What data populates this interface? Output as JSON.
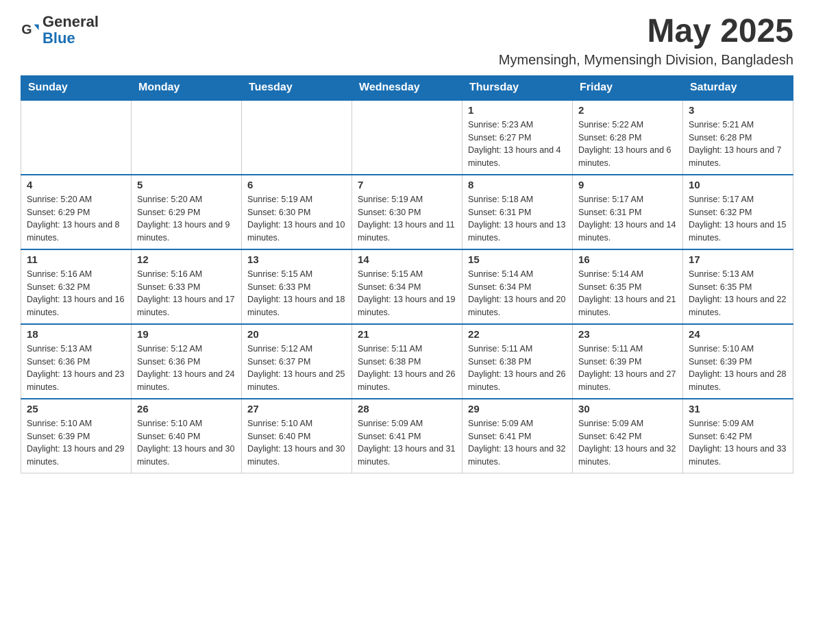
{
  "header": {
    "logo": {
      "general": "General",
      "blue": "Blue"
    },
    "title": "May 2025",
    "subtitle": "Mymensingh, Mymensingh Division, Bangladesh"
  },
  "calendar": {
    "days_of_week": [
      "Sunday",
      "Monday",
      "Tuesday",
      "Wednesday",
      "Thursday",
      "Friday",
      "Saturday"
    ],
    "weeks": [
      [
        {
          "day": "",
          "info": ""
        },
        {
          "day": "",
          "info": ""
        },
        {
          "day": "",
          "info": ""
        },
        {
          "day": "",
          "info": ""
        },
        {
          "day": "1",
          "info": "Sunrise: 5:23 AM\nSunset: 6:27 PM\nDaylight: 13 hours and 4 minutes."
        },
        {
          "day": "2",
          "info": "Sunrise: 5:22 AM\nSunset: 6:28 PM\nDaylight: 13 hours and 6 minutes."
        },
        {
          "day": "3",
          "info": "Sunrise: 5:21 AM\nSunset: 6:28 PM\nDaylight: 13 hours and 7 minutes."
        }
      ],
      [
        {
          "day": "4",
          "info": "Sunrise: 5:20 AM\nSunset: 6:29 PM\nDaylight: 13 hours and 8 minutes."
        },
        {
          "day": "5",
          "info": "Sunrise: 5:20 AM\nSunset: 6:29 PM\nDaylight: 13 hours and 9 minutes."
        },
        {
          "day": "6",
          "info": "Sunrise: 5:19 AM\nSunset: 6:30 PM\nDaylight: 13 hours and 10 minutes."
        },
        {
          "day": "7",
          "info": "Sunrise: 5:19 AM\nSunset: 6:30 PM\nDaylight: 13 hours and 11 minutes."
        },
        {
          "day": "8",
          "info": "Sunrise: 5:18 AM\nSunset: 6:31 PM\nDaylight: 13 hours and 13 minutes."
        },
        {
          "day": "9",
          "info": "Sunrise: 5:17 AM\nSunset: 6:31 PM\nDaylight: 13 hours and 14 minutes."
        },
        {
          "day": "10",
          "info": "Sunrise: 5:17 AM\nSunset: 6:32 PM\nDaylight: 13 hours and 15 minutes."
        }
      ],
      [
        {
          "day": "11",
          "info": "Sunrise: 5:16 AM\nSunset: 6:32 PM\nDaylight: 13 hours and 16 minutes."
        },
        {
          "day": "12",
          "info": "Sunrise: 5:16 AM\nSunset: 6:33 PM\nDaylight: 13 hours and 17 minutes."
        },
        {
          "day": "13",
          "info": "Sunrise: 5:15 AM\nSunset: 6:33 PM\nDaylight: 13 hours and 18 minutes."
        },
        {
          "day": "14",
          "info": "Sunrise: 5:15 AM\nSunset: 6:34 PM\nDaylight: 13 hours and 19 minutes."
        },
        {
          "day": "15",
          "info": "Sunrise: 5:14 AM\nSunset: 6:34 PM\nDaylight: 13 hours and 20 minutes."
        },
        {
          "day": "16",
          "info": "Sunrise: 5:14 AM\nSunset: 6:35 PM\nDaylight: 13 hours and 21 minutes."
        },
        {
          "day": "17",
          "info": "Sunrise: 5:13 AM\nSunset: 6:35 PM\nDaylight: 13 hours and 22 minutes."
        }
      ],
      [
        {
          "day": "18",
          "info": "Sunrise: 5:13 AM\nSunset: 6:36 PM\nDaylight: 13 hours and 23 minutes."
        },
        {
          "day": "19",
          "info": "Sunrise: 5:12 AM\nSunset: 6:36 PM\nDaylight: 13 hours and 24 minutes."
        },
        {
          "day": "20",
          "info": "Sunrise: 5:12 AM\nSunset: 6:37 PM\nDaylight: 13 hours and 25 minutes."
        },
        {
          "day": "21",
          "info": "Sunrise: 5:11 AM\nSunset: 6:38 PM\nDaylight: 13 hours and 26 minutes."
        },
        {
          "day": "22",
          "info": "Sunrise: 5:11 AM\nSunset: 6:38 PM\nDaylight: 13 hours and 26 minutes."
        },
        {
          "day": "23",
          "info": "Sunrise: 5:11 AM\nSunset: 6:39 PM\nDaylight: 13 hours and 27 minutes."
        },
        {
          "day": "24",
          "info": "Sunrise: 5:10 AM\nSunset: 6:39 PM\nDaylight: 13 hours and 28 minutes."
        }
      ],
      [
        {
          "day": "25",
          "info": "Sunrise: 5:10 AM\nSunset: 6:39 PM\nDaylight: 13 hours and 29 minutes."
        },
        {
          "day": "26",
          "info": "Sunrise: 5:10 AM\nSunset: 6:40 PM\nDaylight: 13 hours and 30 minutes."
        },
        {
          "day": "27",
          "info": "Sunrise: 5:10 AM\nSunset: 6:40 PM\nDaylight: 13 hours and 30 minutes."
        },
        {
          "day": "28",
          "info": "Sunrise: 5:09 AM\nSunset: 6:41 PM\nDaylight: 13 hours and 31 minutes."
        },
        {
          "day": "29",
          "info": "Sunrise: 5:09 AM\nSunset: 6:41 PM\nDaylight: 13 hours and 32 minutes."
        },
        {
          "day": "30",
          "info": "Sunrise: 5:09 AM\nSunset: 6:42 PM\nDaylight: 13 hours and 32 minutes."
        },
        {
          "day": "31",
          "info": "Sunrise: 5:09 AM\nSunset: 6:42 PM\nDaylight: 13 hours and 33 minutes."
        }
      ]
    ]
  }
}
